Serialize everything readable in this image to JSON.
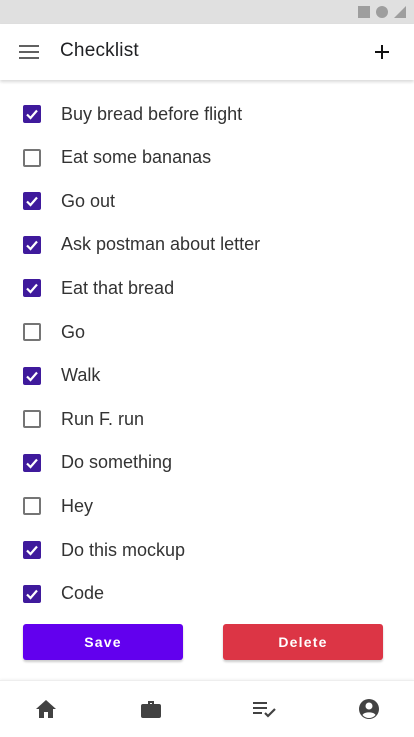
{
  "header": {
    "title": "Checklist"
  },
  "icons": {
    "menu": "menu-icon",
    "add": "plus-icon",
    "check": "check-icon",
    "home": "home-icon",
    "briefcase": "briefcase-icon",
    "checklist": "checklist-icon",
    "account": "account-circle-icon"
  },
  "checklist": {
    "items": [
      {
        "label": "Buy bread before flight",
        "checked": true
      },
      {
        "label": "Eat some bananas",
        "checked": false
      },
      {
        "label": "Go out",
        "checked": true
      },
      {
        "label": "Ask postman about letter",
        "checked": true
      },
      {
        "label": "Eat that bread",
        "checked": true
      },
      {
        "label": "Go",
        "checked": false
      },
      {
        "label": "Walk",
        "checked": true
      },
      {
        "label": "Run F. run",
        "checked": false
      },
      {
        "label": "Do something",
        "checked": true
      },
      {
        "label": "Hey",
        "checked": false
      },
      {
        "label": "Do this mockup",
        "checked": true
      },
      {
        "label": "Code",
        "checked": true
      }
    ]
  },
  "actions": {
    "save_label": "Save",
    "delete_label": "Delete"
  },
  "colors": {
    "checkbox_checked": "#3f1a9c",
    "save_button": "#6200ee",
    "delete_button": "#dc3545",
    "icon": "#424242",
    "status_bar": "#e0e0e0"
  }
}
